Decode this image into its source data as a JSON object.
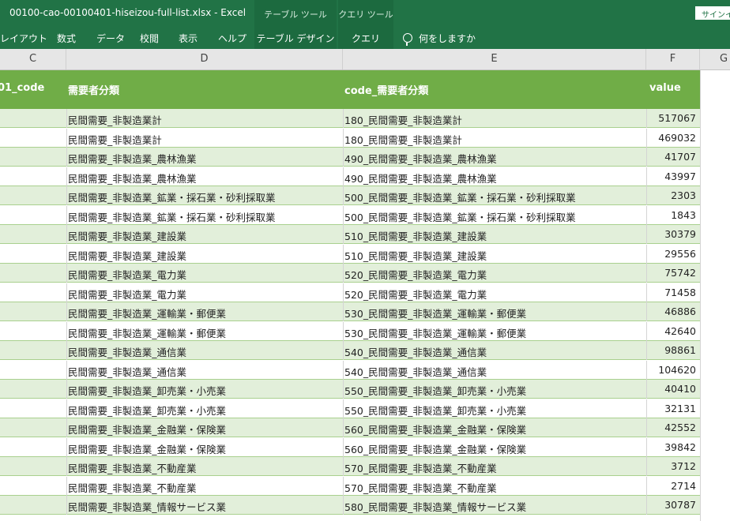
{
  "title_bar": {
    "title": "00100-cao-00100401-hiseizou-full-list.xlsx  -  Excel",
    "context_tabs": [
      "テーブル ツール",
      "クエリ ツール"
    ],
    "signin": "サインイン"
  },
  "ribbon": {
    "tabs": [
      "レイアウト",
      "数式",
      "データ",
      "校閲",
      "表示",
      "ヘルプ"
    ],
    "context_tabs": [
      "テーブル デザイン",
      "クエリ"
    ],
    "tell_me": "何をしますか"
  },
  "columns": [
    "C",
    "D",
    "E",
    "F",
    "G"
  ],
  "table": {
    "headers": [
      "01_code",
      "需要者分類",
      "code_需要者分類",
      "value"
    ],
    "rows": [
      [
        "民間需要_非製造業計",
        "180_民間需要_非製造業計",
        "517067"
      ],
      [
        "民間需要_非製造業計",
        "180_民間需要_非製造業計",
        "469032"
      ],
      [
        "民間需要_非製造業_農林漁業",
        "490_民間需要_非製造業_農林漁業",
        "41707"
      ],
      [
        "民間需要_非製造業_農林漁業",
        "490_民間需要_非製造業_農林漁業",
        "43997"
      ],
      [
        "民間需要_非製造業_鉱業・採石業・砂利採取業",
        "500_民間需要_非製造業_鉱業・採石業・砂利採取業",
        "2303"
      ],
      [
        "民間需要_非製造業_鉱業・採石業・砂利採取業",
        "500_民間需要_非製造業_鉱業・採石業・砂利採取業",
        "1843"
      ],
      [
        "民間需要_非製造業_建設業",
        "510_民間需要_非製造業_建設業",
        "30379"
      ],
      [
        "民間需要_非製造業_建設業",
        "510_民間需要_非製造業_建設業",
        "29556"
      ],
      [
        "民間需要_非製造業_電力業",
        "520_民間需要_非製造業_電力業",
        "75742"
      ],
      [
        "民間需要_非製造業_電力業",
        "520_民間需要_非製造業_電力業",
        "71458"
      ],
      [
        "民間需要_非製造業_運輸業・郵便業",
        "530_民間需要_非製造業_運輸業・郵便業",
        "46886"
      ],
      [
        "民間需要_非製造業_運輸業・郵便業",
        "530_民間需要_非製造業_運輸業・郵便業",
        "42640"
      ],
      [
        "民間需要_非製造業_通信業",
        "540_民間需要_非製造業_通信業",
        "98861"
      ],
      [
        "民間需要_非製造業_通信業",
        "540_民間需要_非製造業_通信業",
        "104620"
      ],
      [
        "民間需要_非製造業_卸売業・小売業",
        "550_民間需要_非製造業_卸売業・小売業",
        "40410"
      ],
      [
        "民間需要_非製造業_卸売業・小売業",
        "550_民間需要_非製造業_卸売業・小売業",
        "32131"
      ],
      [
        "民間需要_非製造業_金融業・保険業",
        "560_民間需要_非製造業_金融業・保険業",
        "42552"
      ],
      [
        "民間需要_非製造業_金融業・保険業",
        "560_民間需要_非製造業_金融業・保険業",
        "39842"
      ],
      [
        "民間需要_非製造業_不動産業",
        "570_民間需要_非製造業_不動産業",
        "3712"
      ],
      [
        "民間需要_非製造業_不動産業",
        "570_民間需要_非製造業_不動産業",
        "2714"
      ],
      [
        "民間需要_非製造業_情報サービス業",
        "580_民間需要_非製造業_情報サービス業",
        "30787"
      ]
    ]
  },
  "colors": {
    "excel_green": "#217346",
    "header_green": "#70ad47",
    "band_green": "#e2efda"
  }
}
